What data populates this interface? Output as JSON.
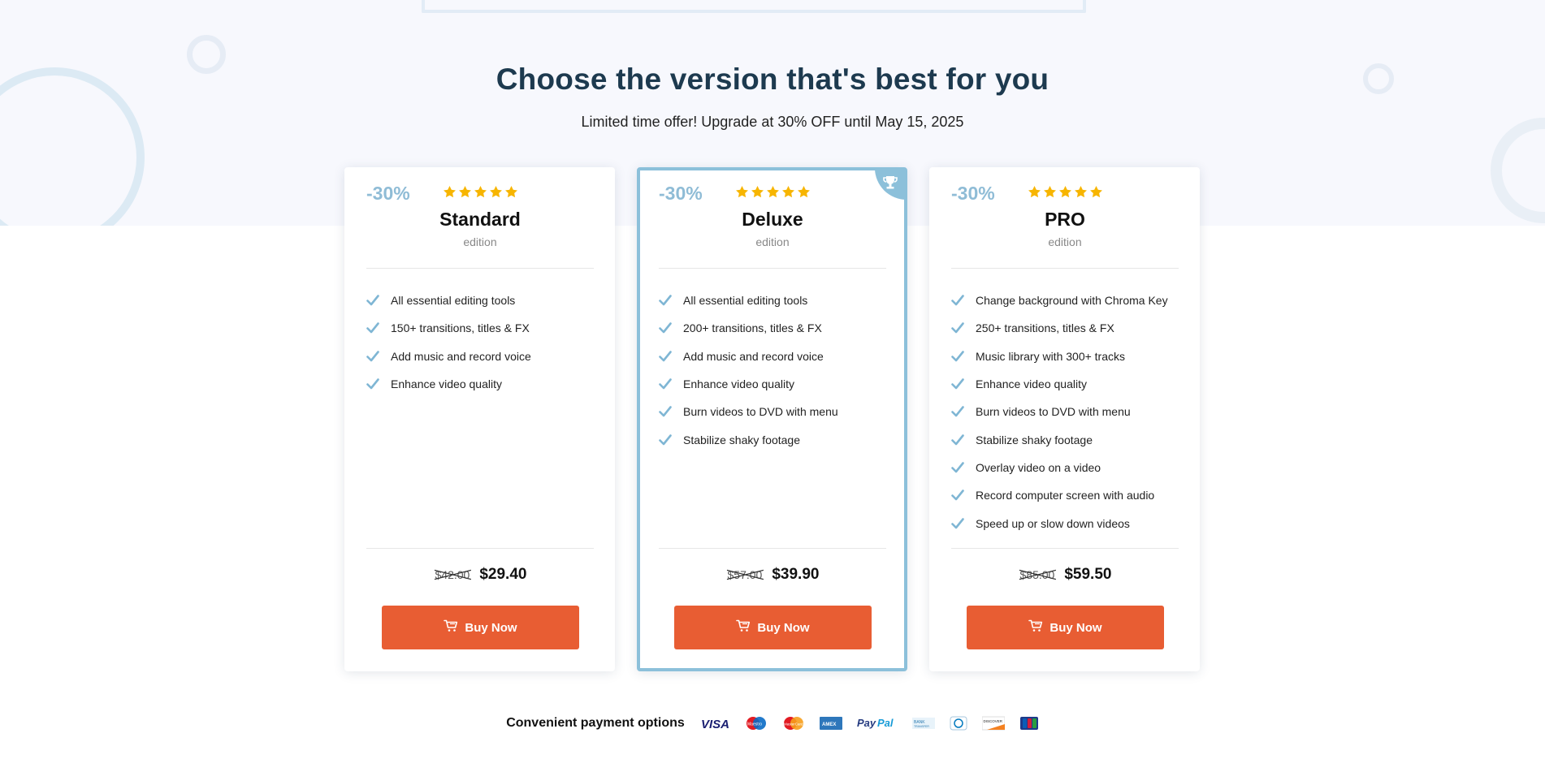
{
  "header": {
    "title": "Choose the version that's best for you",
    "subtitle": "Limited time offer! Upgrade at 30% OFF until May 15, 2025"
  },
  "plans": [
    {
      "discount": "-30%",
      "rating": 5,
      "name": "Standard",
      "edition_word": "edition",
      "features": [
        "All essential editing tools",
        "150+ transitions, titles & FX",
        "Add music and record voice",
        "Enhance video quality"
      ],
      "old_price": "$42.00",
      "price": "$29.40",
      "button_label": "Buy Now",
      "featured": false
    },
    {
      "discount": "-30%",
      "rating": 5,
      "name": "Deluxe",
      "edition_word": "edition",
      "features": [
        "All essential editing tools",
        "200+ transitions, titles & FX",
        "Add music and record voice",
        "Enhance video quality",
        "Burn videos to DVD with menu",
        "Stabilize shaky footage"
      ],
      "old_price": "$57.00",
      "price": "$39.90",
      "button_label": "Buy Now",
      "featured": true
    },
    {
      "discount": "-30%",
      "rating": 5,
      "name": "PRO",
      "edition_word": "edition",
      "features": [
        "Change background with Chroma Key",
        "250+ transitions, titles & FX",
        "Music library with 300+ tracks",
        "Enhance video quality",
        "Burn videos to DVD with menu",
        "Stabilize shaky footage",
        "Overlay video on a video",
        "Record computer screen with audio",
        "Speed up or slow down videos"
      ],
      "old_price": "$85.00",
      "price": "$59.50",
      "button_label": "Buy Now",
      "featured": false
    }
  ],
  "payment": {
    "label": "Convenient payment options",
    "methods": [
      {
        "name": "VISA",
        "icon": "visa-icon"
      },
      {
        "name": "Maestro",
        "icon": "maestro-icon"
      },
      {
        "name": "MasterCard",
        "icon": "mastercard-icon"
      },
      {
        "name": "AMEX",
        "icon": "amex-icon"
      },
      {
        "name": "PayPal",
        "icon": "paypal-icon"
      },
      {
        "name": "BANK TRANSFER",
        "icon": "bank-transfer-icon"
      },
      {
        "name": "Diners Club",
        "icon": "diners-club-icon"
      },
      {
        "name": "DISCOVER",
        "icon": "discover-icon"
      },
      {
        "name": "JCB",
        "icon": "jcb-icon"
      }
    ]
  },
  "colors": {
    "accent": "#e85d33",
    "discount": "#8fbcd6",
    "featured_border": "#8cc0da",
    "check": "#7fb6d4",
    "star": "#f7b500",
    "heading": "#1d3a4f"
  }
}
